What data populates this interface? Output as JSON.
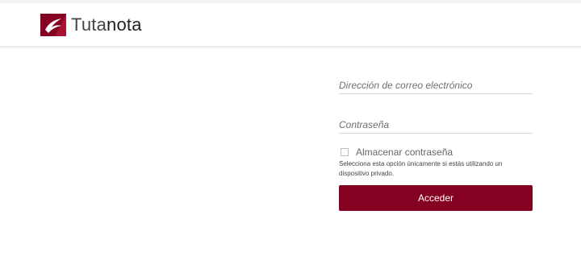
{
  "header": {
    "logo_part1": "Tuta",
    "logo_part2": "nota",
    "brand_color": "#850122"
  },
  "login": {
    "email_placeholder": "Dirección de correo electrónico",
    "email_value": "",
    "password_placeholder": "Contraseña",
    "password_value": "",
    "remember_label": "Almacenar contraseña",
    "remember_checked": false,
    "remember_hint": "Selecciona esta opción únicamente si estás utilizando un dispositivo privado.",
    "submit_label": "Acceder"
  }
}
